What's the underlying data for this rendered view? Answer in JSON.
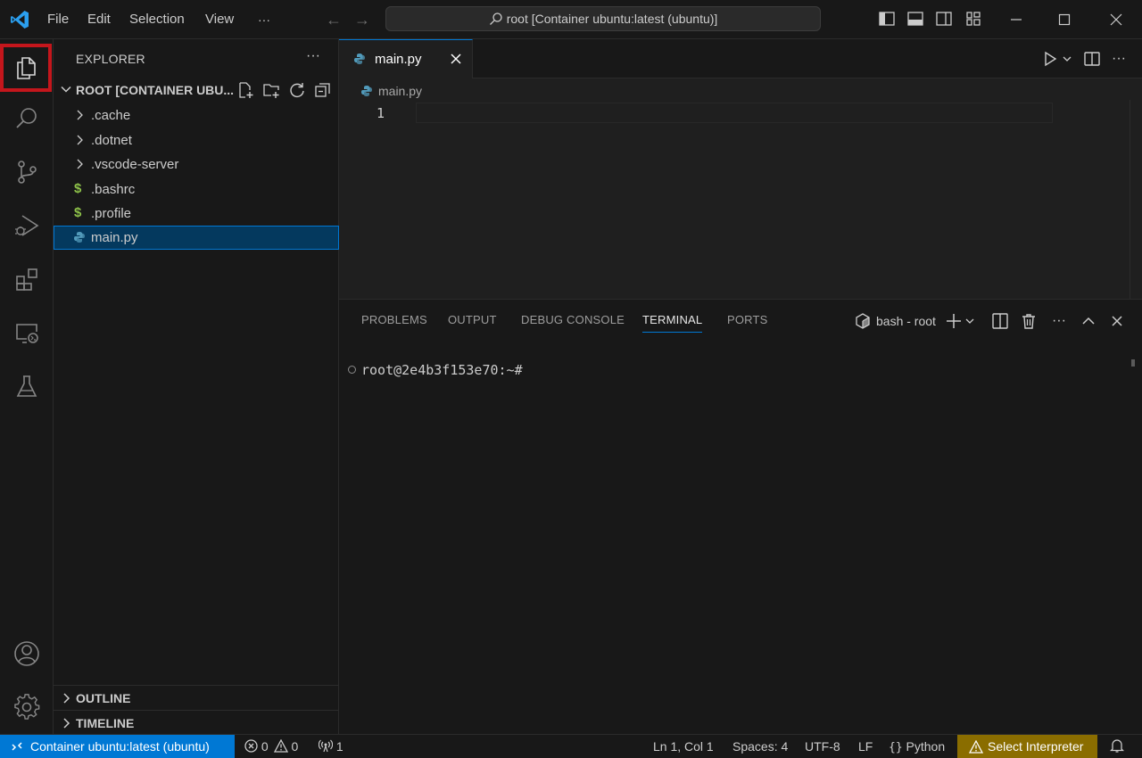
{
  "titlebar": {
    "menu": [
      "File",
      "Edit",
      "Selection",
      "View"
    ],
    "more": "···",
    "search_text": "root [Container ubuntu:latest (ubuntu)]"
  },
  "sidebar": {
    "title": "EXPLORER",
    "more": "···",
    "root_label": "ROOT [CONTAINER UBU...",
    "items": [
      {
        "label": ".cache",
        "type": "folder"
      },
      {
        "label": ".dotnet",
        "type": "folder"
      },
      {
        "label": ".vscode-server",
        "type": "folder"
      },
      {
        "label": ".bashrc",
        "type": "shell"
      },
      {
        "label": ".profile",
        "type": "shell"
      },
      {
        "label": "main.py",
        "type": "python",
        "selected": true
      }
    ],
    "outline": "OUTLINE",
    "timeline": "TIMELINE"
  },
  "editor": {
    "tab_label": "main.py",
    "breadcrumb": "main.py",
    "line_number": "1"
  },
  "panel": {
    "tabs": [
      "PROBLEMS",
      "OUTPUT",
      "DEBUG CONSOLE",
      "TERMINAL",
      "PORTS"
    ],
    "active_tab": "TERMINAL",
    "terminal_name": "bash - root",
    "prompt": "root@2e4b3f153e70:~#"
  },
  "statusbar": {
    "remote": "Container ubuntu:latest (ubuntu)",
    "errors": "0",
    "warnings": "0",
    "ports": "1",
    "position": "Ln 1, Col 1",
    "spaces": "Spaces: 4",
    "encoding": "UTF-8",
    "eol": "LF",
    "language": "Python",
    "interpreter": "Select Interpreter"
  },
  "colors": {
    "accent": "#0078d4",
    "highlight_box": "#c4161c",
    "interpreter_bg": "#8a6d00",
    "shell_icon": "#8dc149",
    "python_icon": "#519aba"
  }
}
